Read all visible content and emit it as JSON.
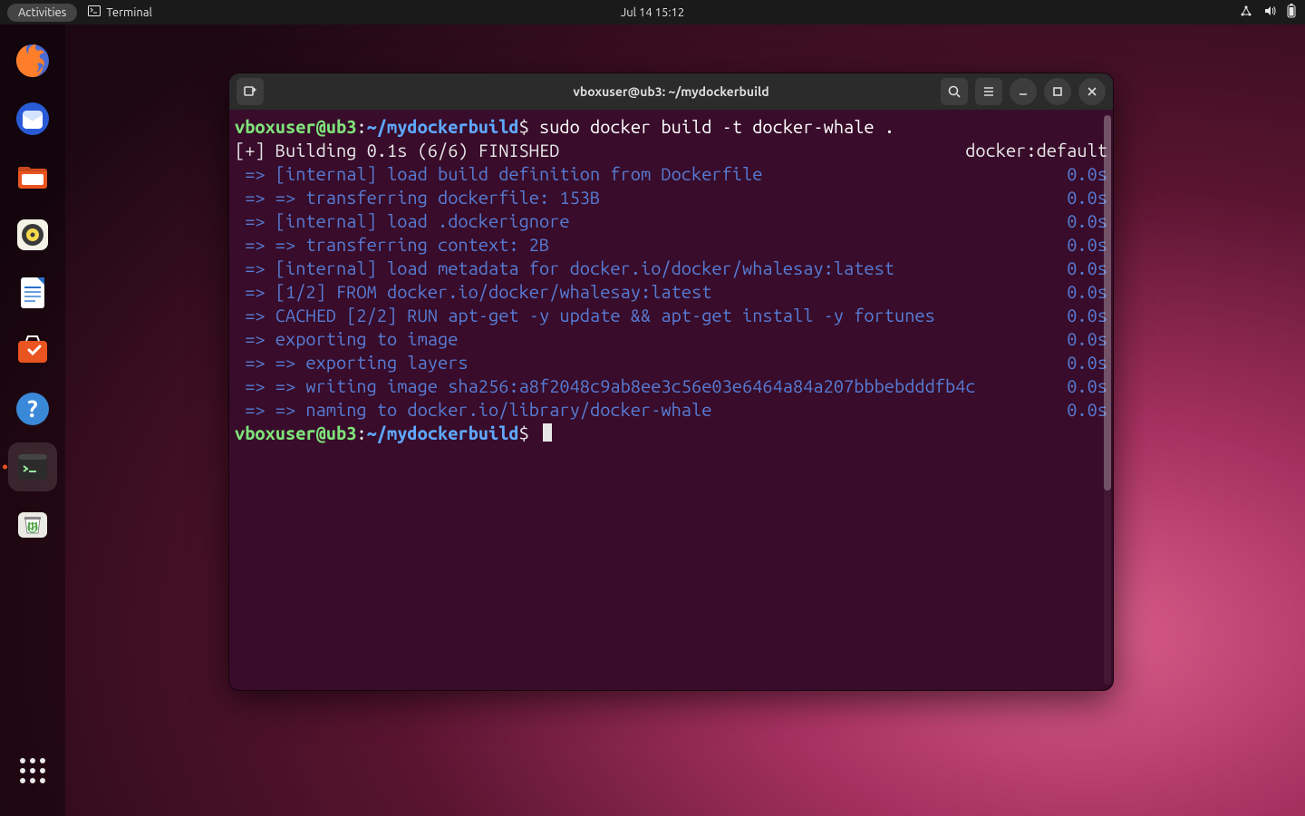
{
  "topbar": {
    "activities": "Activities",
    "appmenu_label": "Terminal",
    "clock": "Jul 14  15:12"
  },
  "dock": {
    "items": [
      {
        "name": "firefox"
      },
      {
        "name": "thunderbird"
      },
      {
        "name": "files"
      },
      {
        "name": "rhythmbox"
      },
      {
        "name": "libreoffice-writer"
      },
      {
        "name": "software"
      },
      {
        "name": "help"
      },
      {
        "name": "terminal"
      },
      {
        "name": "trash"
      }
    ],
    "grid": "show-applications"
  },
  "terminal": {
    "title": "vboxuser@ub3: ~/mydockerbuild",
    "prompt": {
      "user": "vboxuser@ub3",
      "sep": ":",
      "path": "~/mydockerbuild",
      "sigil": "$"
    },
    "command": "sudo docker build -t docker-whale .",
    "build_header_left": "[+] Building 0.1s (6/6) FINISHED",
    "build_header_right": "docker:default",
    "lines": [
      {
        "l": " => [internal] load build definition from Dockerfile",
        "r": "0.0s"
      },
      {
        "l": " => => transferring dockerfile: 153B",
        "r": "0.0s"
      },
      {
        "l": " => [internal] load .dockerignore",
        "r": "0.0s"
      },
      {
        "l": " => => transferring context: 2B",
        "r": "0.0s"
      },
      {
        "l": " => [internal] load metadata for docker.io/docker/whalesay:latest",
        "r": "0.0s"
      },
      {
        "l": " => [1/2] FROM docker.io/docker/whalesay:latest",
        "r": "0.0s"
      },
      {
        "l": " => CACHED [2/2] RUN apt-get -y update && apt-get install -y fortunes",
        "r": "0.0s"
      },
      {
        "l": " => exporting to image",
        "r": "0.0s"
      },
      {
        "l": " => => exporting layers",
        "r": "0.0s"
      },
      {
        "l": " => => writing image sha256:a8f2048c9ab8ee3c56e03e6464a84a207bbbebdddfb4c",
        "r": "0.0s"
      },
      {
        "l": " => => naming to docker.io/library/docker-whale",
        "r": "0.0s"
      }
    ]
  }
}
